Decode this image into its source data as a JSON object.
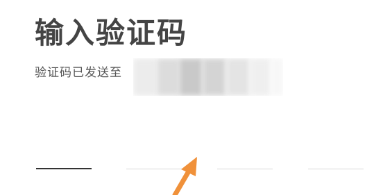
{
  "page": {
    "title": "输入验证码",
    "subtitle": "验证码已发送至"
  },
  "code_inputs": {
    "count": 4,
    "active_index": 0,
    "values": [
      "",
      "",
      "",
      ""
    ]
  },
  "colors": {
    "title": "#444444",
    "subtitle": "#555555",
    "active_underline": "#333333",
    "inactive_underline": "#d8d8d8",
    "annotation_arrow": "#f0913a"
  },
  "icons": {
    "annotation": "arrow-up-right-icon"
  }
}
